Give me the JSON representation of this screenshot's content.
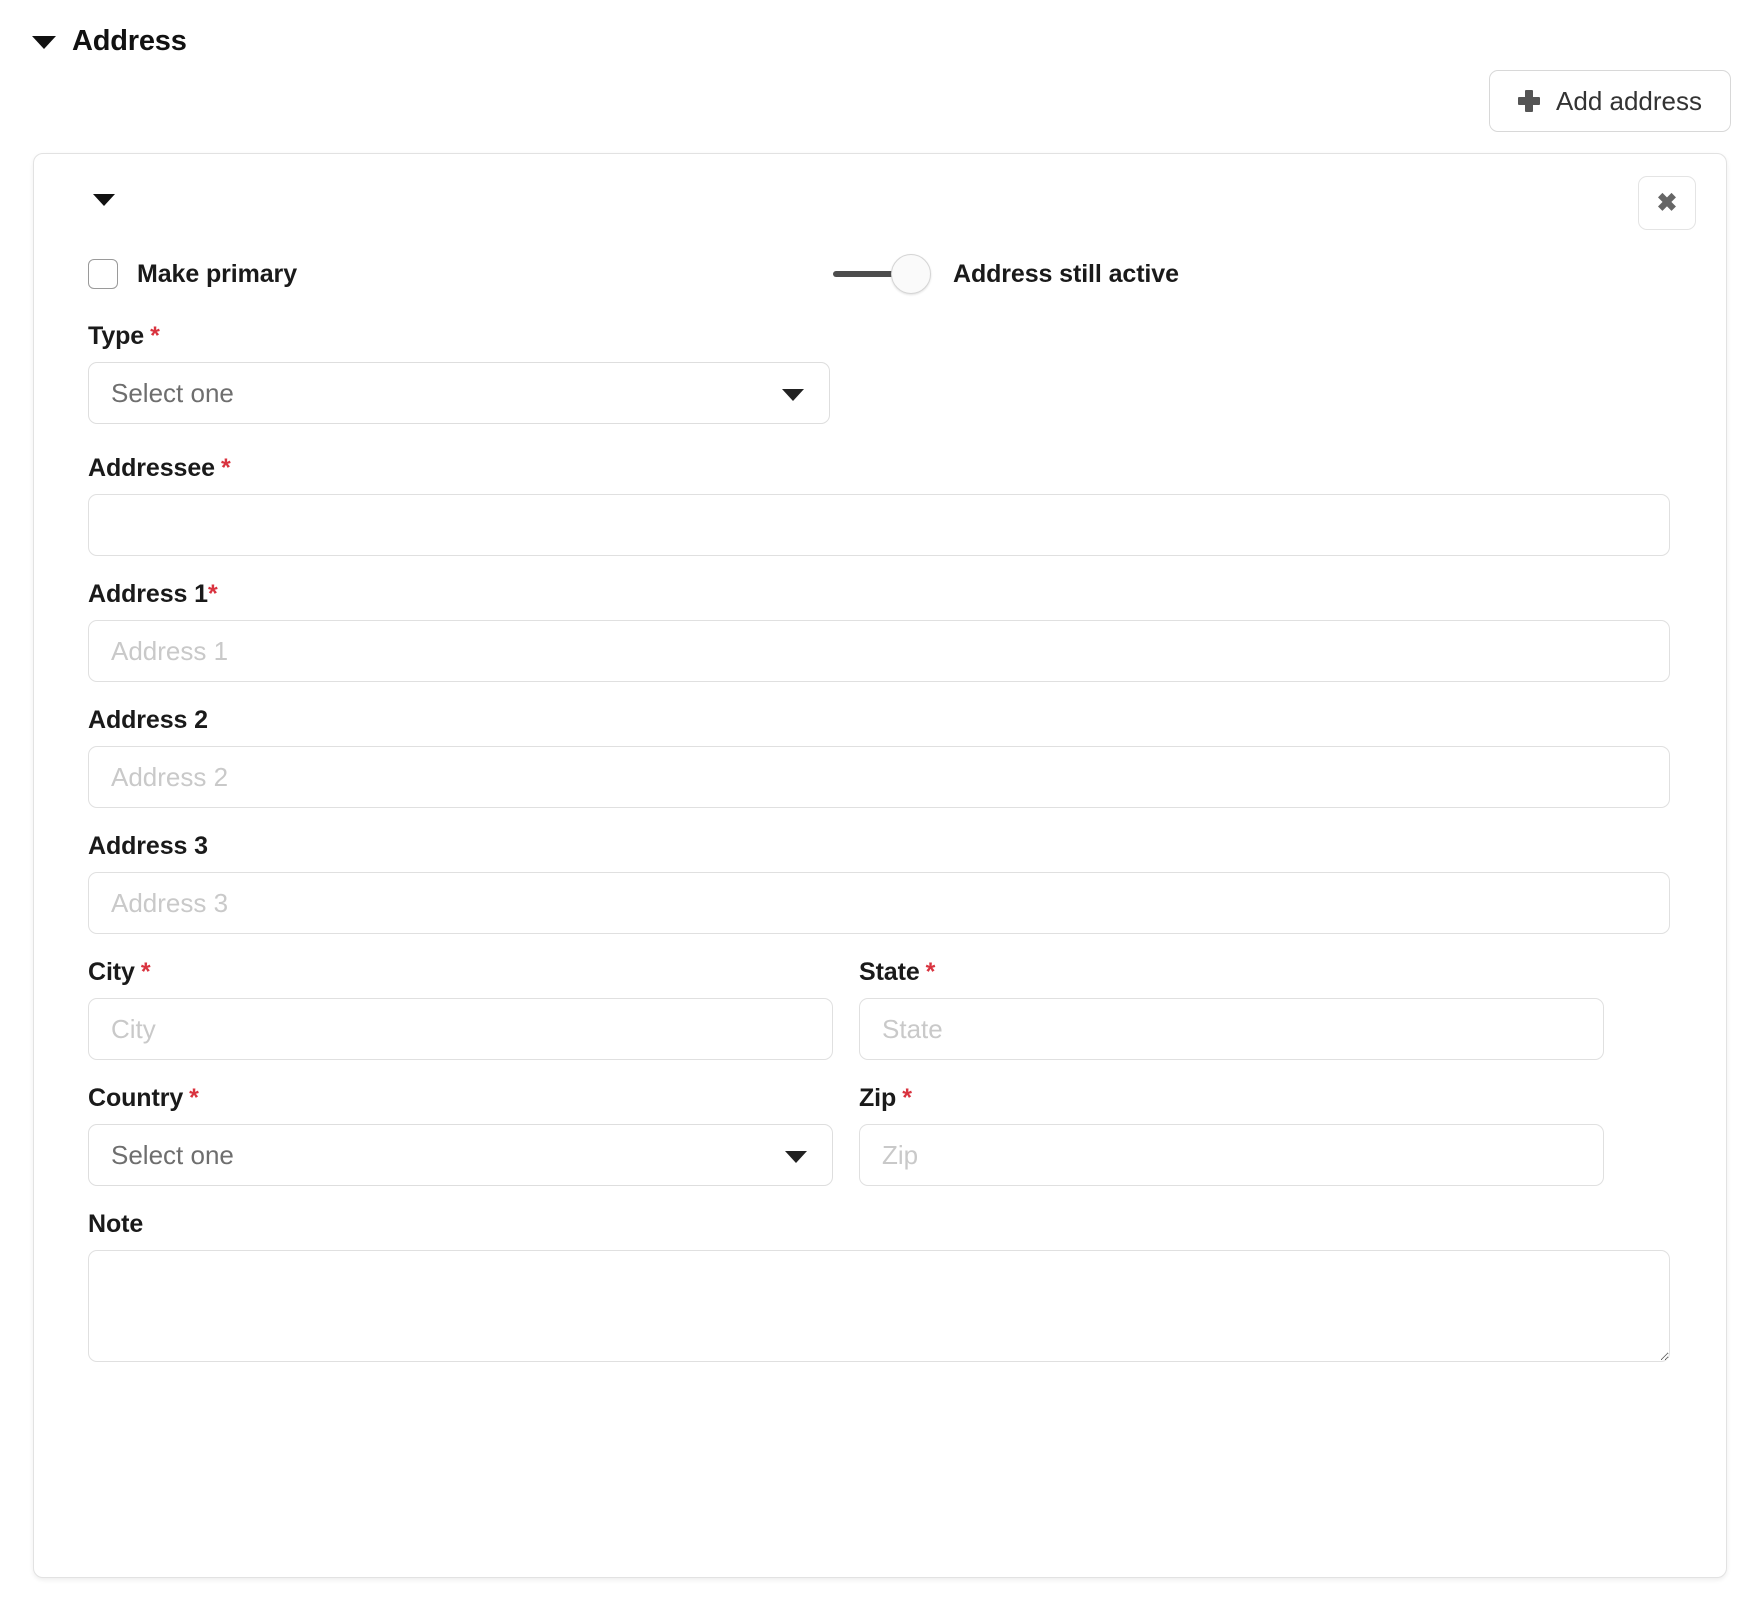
{
  "section": {
    "title": "Address",
    "collapse_icon": "caret-down-icon"
  },
  "toolbar": {
    "add_address_label": "Add address",
    "add_icon": "plus-icon"
  },
  "card": {
    "collapse_icon": "caret-down-icon",
    "close_label": "✖",
    "make_primary_label": "Make primary",
    "make_primary_checked": false,
    "still_active_label": "Address still active",
    "still_active_on": true,
    "fields": {
      "type": {
        "label": "Type",
        "required": "*",
        "value": "Select one"
      },
      "addressee": {
        "label": "Addressee",
        "required": "*",
        "placeholder": "",
        "value": ""
      },
      "address1": {
        "label": "Address 1",
        "required": "*",
        "placeholder": "Address 1",
        "value": ""
      },
      "address2": {
        "label": "Address 2",
        "required": "",
        "placeholder": "Address 2",
        "value": ""
      },
      "address3": {
        "label": "Address 3",
        "required": "",
        "placeholder": "Address 3",
        "value": ""
      },
      "city": {
        "label": "City",
        "required": "*",
        "placeholder": "City",
        "value": ""
      },
      "state": {
        "label": "State",
        "required": "*",
        "placeholder": "State",
        "value": ""
      },
      "country": {
        "label": "Country",
        "required": "*",
        "value": "Select one"
      },
      "zip": {
        "label": "Zip",
        "required": "*",
        "placeholder": "Zip",
        "value": ""
      },
      "note": {
        "label": "Note",
        "required": "",
        "placeholder": "",
        "value": ""
      }
    }
  },
  "colors": {
    "required_asterisk": "#d9333f",
    "border": "#e0e0e0",
    "text": "#1a1a1a",
    "placeholder": "#c9c9c9",
    "toggle_track": "#4d4d4d"
  }
}
